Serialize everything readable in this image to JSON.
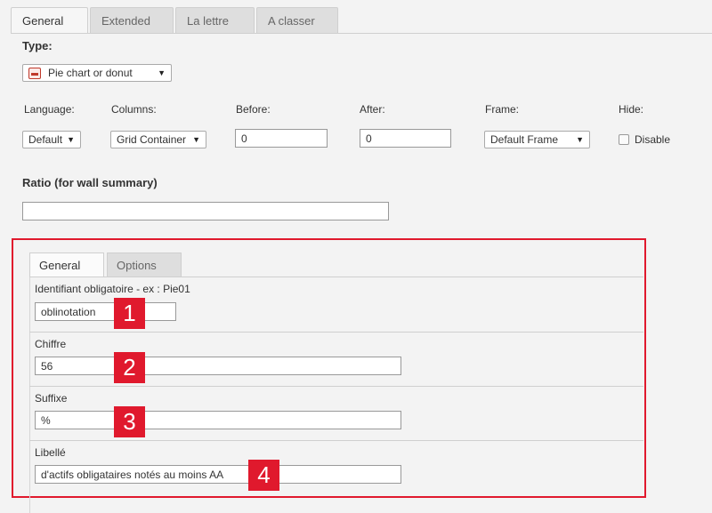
{
  "tabs": [
    "General",
    "Extended",
    "La lettre",
    "A classer"
  ],
  "type": {
    "label": "Type:",
    "value": "Pie chart or donut"
  },
  "fields": {
    "language": {
      "label": "Language:",
      "value": "Default"
    },
    "columns": {
      "label": "Columns:",
      "value": "Grid Container"
    },
    "before": {
      "label": "Before:",
      "value": "0"
    },
    "after": {
      "label": "After:",
      "value": "0"
    },
    "frame": {
      "label": "Frame:",
      "value": "Default Frame"
    },
    "hide": {
      "label": "Hide:",
      "checkbox_label": "Disable"
    }
  },
  "ratio": {
    "label": "Ratio (for wall summary)",
    "value": ""
  },
  "inner_tabs": [
    "General",
    "Options"
  ],
  "inner_fields": [
    {
      "label": "Identifiant obligatoire - ex : Pie01",
      "value": "oblinotation",
      "badge": "1"
    },
    {
      "label": "Chiffre",
      "value": "56",
      "badge": "2"
    },
    {
      "label": "Suffixe",
      "value": "%",
      "badge": "3"
    },
    {
      "label": "Libellé",
      "value": "d'actifs obligataires notés au moins AA",
      "badge": "4"
    }
  ],
  "colors": {
    "highlight": "#e0192d",
    "badge_text": "#ffffff"
  }
}
